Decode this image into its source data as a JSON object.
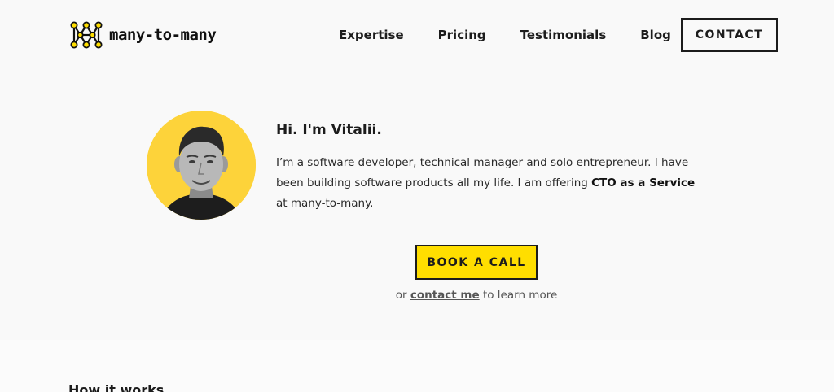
{
  "header": {
    "brand": "many-to-many",
    "nav": [
      "Expertise",
      "Pricing",
      "Testimonials",
      "Blog"
    ],
    "contact_label": "CONTACT"
  },
  "hero": {
    "title": "Hi. I'm Vitalii.",
    "text_part1": "I’m a software developer, technical manager and solo entrepreneur. I have been building software products all my life. I am offering ",
    "text_strong": "CTO as a Service",
    "text_part2": " at many-to-many.",
    "cta_label": "BOOK A CALL",
    "learn_prefix": "or ",
    "learn_link": "contact me",
    "learn_suffix": " to learn more"
  },
  "section": {
    "how_title": "How it works"
  },
  "colors": {
    "accent": "#ffde00",
    "avatar_bg": "#fdd33a",
    "text": "#1c1c1c",
    "background": "#f9f9f9"
  },
  "icons": {
    "logo": "network-graph-logo-icon",
    "avatar": "portrait-photo"
  }
}
